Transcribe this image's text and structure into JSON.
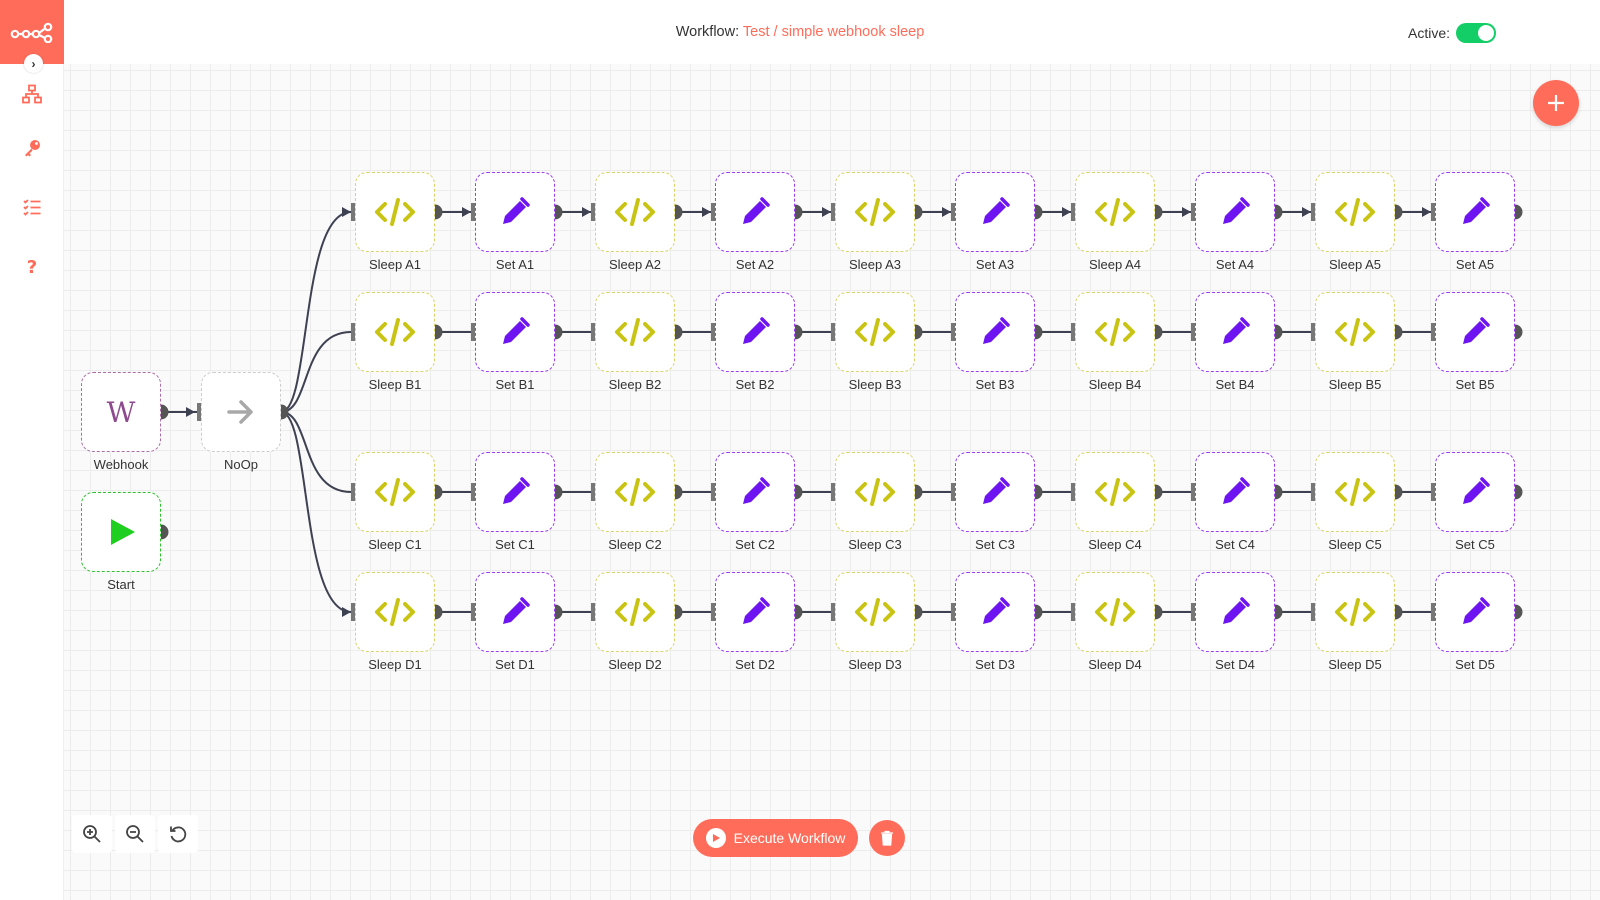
{
  "header": {
    "workflow_label": "Workflow:",
    "workflow_project": "Test",
    "workflow_separator": " / ",
    "workflow_name": "simple webhook sleep",
    "active_label": "Active:",
    "active": true
  },
  "sidebar": {
    "items": [
      {
        "icon": "network-icon",
        "name": "workflows"
      },
      {
        "icon": "key-icon",
        "name": "credentials"
      },
      {
        "icon": "list-icon",
        "name": "executions"
      },
      {
        "icon": "question-icon",
        "name": "help"
      }
    ]
  },
  "colors": {
    "accent": "#ff6d5a",
    "code_icon": "#c9c414",
    "set_icon": "#6e13f2",
    "start_icon": "#1fcf1f",
    "active_toggle": "#13ce66"
  },
  "nodes": {
    "webhook": {
      "label": "Webhook"
    },
    "noop": {
      "label": "NoOp"
    },
    "start": {
      "label": "Start"
    },
    "rows": [
      [
        "Sleep A1",
        "Set A1",
        "Sleep A2",
        "Set A2",
        "Sleep A3",
        "Set A3",
        "Sleep A4",
        "Set A4",
        "Sleep A5",
        "Set A5"
      ],
      [
        "Sleep B1",
        "Set B1",
        "Sleep B2",
        "Set B2",
        "Sleep B3",
        "Set B3",
        "Sleep B4",
        "Set B4",
        "Sleep B5",
        "Set B5"
      ],
      [
        "Sleep C1",
        "Set C1",
        "Sleep C2",
        "Set C2",
        "Sleep C3",
        "Set C3",
        "Sleep C4",
        "Set C4",
        "Sleep C5",
        "Set C5"
      ],
      [
        "Sleep D1",
        "Set D1",
        "Sleep D2",
        "Set D2",
        "Sleep D3",
        "Set D3",
        "Sleep D4",
        "Set D4",
        "Sleep D5",
        "Set D5"
      ]
    ]
  },
  "footer": {
    "execute_label": "Execute Workflow"
  }
}
